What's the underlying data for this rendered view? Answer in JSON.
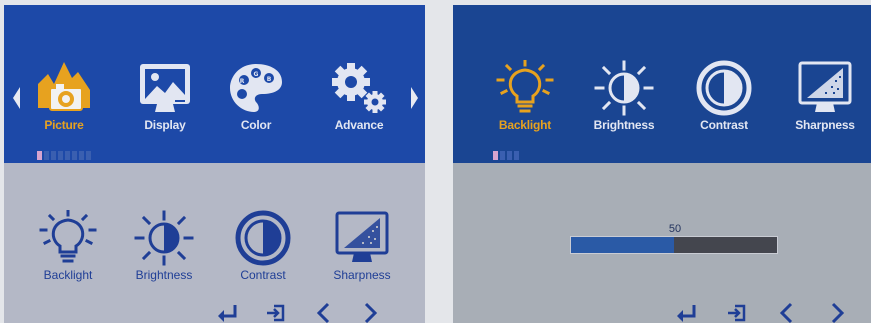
{
  "left_panel": {
    "main_menu": [
      {
        "label": "Picture",
        "icon": "picture-icon",
        "active": true
      },
      {
        "label": "Display",
        "icon": "display-icon",
        "active": false
      },
      {
        "label": "Color",
        "icon": "color-palette-icon",
        "active": false
      },
      {
        "label": "Advance",
        "icon": "gear-icon",
        "active": false
      }
    ],
    "page_dots": {
      "total": 8,
      "current": 1
    },
    "sub_menu": [
      {
        "label": "Backlight",
        "icon": "lightbulb-icon"
      },
      {
        "label": "Brightness",
        "icon": "sun-icon"
      },
      {
        "label": "Contrast",
        "icon": "contrast-icon"
      },
      {
        "label": "Sharpness",
        "icon": "sharpness-icon"
      }
    ],
    "nav_buttons": [
      "enter-icon",
      "exit-icon",
      "chevron-left-icon",
      "chevron-right-icon"
    ]
  },
  "right_panel": {
    "sub_menu": [
      {
        "label": "Backlight",
        "icon": "lightbulb-icon",
        "active": true
      },
      {
        "label": "Brightness",
        "icon": "sun-icon",
        "active": false
      },
      {
        "label": "Contrast",
        "icon": "contrast-icon",
        "active": false
      },
      {
        "label": "Sharpness",
        "icon": "sharpness-icon",
        "active": false
      }
    ],
    "page_dots": {
      "total": 4,
      "current": 1
    },
    "slider": {
      "value": "50",
      "fraction": 0.5
    },
    "nav_buttons": [
      "enter-icon",
      "exit-icon",
      "chevron-left-icon",
      "chevron-right-icon"
    ]
  },
  "colors": {
    "menu_band": "#1d49a8",
    "active_label": "#e7a21f",
    "inactive_label": "#e2e6f2",
    "sub_label": "#1f3e96",
    "slider_fill": "#2a5aa6"
  }
}
